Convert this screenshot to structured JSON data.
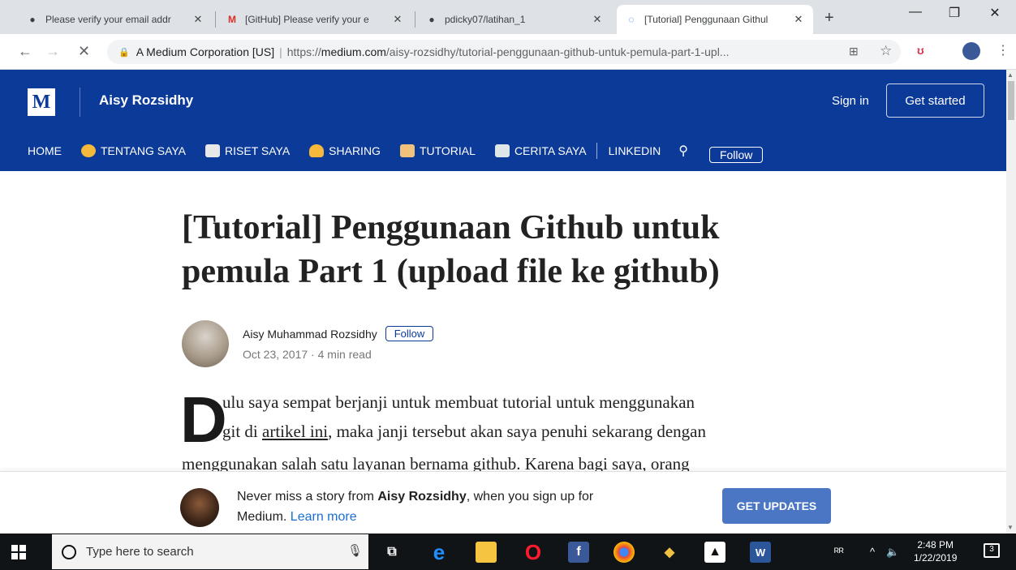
{
  "browser": {
    "tabs": [
      {
        "title": "Please verify your email addr",
        "favicon": "github-icon"
      },
      {
        "title": "[GitHub] Please verify your e",
        "favicon": "gmail-icon"
      },
      {
        "title": "pdicky07/latihan_1",
        "favicon": "github-icon"
      },
      {
        "title": "[Tutorial] Penggunaan Githul",
        "favicon": "loading-icon"
      }
    ],
    "omnibox": {
      "site": "A Medium Corporation [US]",
      "separator": "|",
      "url_prefix": "https://",
      "url_host": "medium.com",
      "url_path": "/aisy-rozsidhy/tutorial-penggunaan-github-untuk-pemula-part-1-upl..."
    }
  },
  "header": {
    "logo": "M",
    "publication": "Aisy Rozsidhy",
    "signin": "Sign in",
    "get_started": "Get started",
    "menu": [
      {
        "label": "HOME",
        "icon": ""
      },
      {
        "label": "TENTANG SAYA",
        "icon": "smiley-emoji-icon",
        "color": "#f6b93b"
      },
      {
        "label": "RISET SAYA",
        "icon": "book-emoji-icon",
        "color": "#e8e8e8"
      },
      {
        "label": "SHARING",
        "icon": "heart-hands-emoji-icon",
        "color": "#f6b93b"
      },
      {
        "label": "TUTORIAL",
        "icon": "teacher-emoji-icon",
        "color": "#f0c27b"
      },
      {
        "label": "CERITA SAYA",
        "icon": "notebook-emoji-icon",
        "color": "#dfe6e9"
      },
      {
        "label": "LINKEDIN",
        "icon": ""
      }
    ],
    "follow": "Follow"
  },
  "article": {
    "title_line1": "[Tutorial] Penggunaan Github untuk",
    "title_line2": "pemula Part 1 (upload file ke github)",
    "author": "Aisy Muhammad Rozsidhy",
    "follow": "Follow",
    "meta": "Oct 23, 2017 · 4 min read",
    "dropcap": "D",
    "line1": "ulu saya sempat berjanji untuk membuat tutorial untuk menggunakan",
    "line2_pre": "git di ",
    "line2_link": "artikel ini",
    "line2_post": ", maka janji tersebut akan saya penuhi sekarang dengan",
    "line3": "menggunakan salah satu layanan bernama github. Karena bagi saya, orang"
  },
  "banner": {
    "text_pre": "Never miss a story from ",
    "text_bold": "Aisy Rozsidhy",
    "text_post": ", when you sign up for",
    "text_line2": "Medium. ",
    "learn_more": "Learn more",
    "button": "GET UPDATES"
  },
  "taskbar": {
    "search_placeholder": "Type here to search",
    "time": "2:48 PM",
    "date": "1/22/2019",
    "notifications": "3"
  }
}
